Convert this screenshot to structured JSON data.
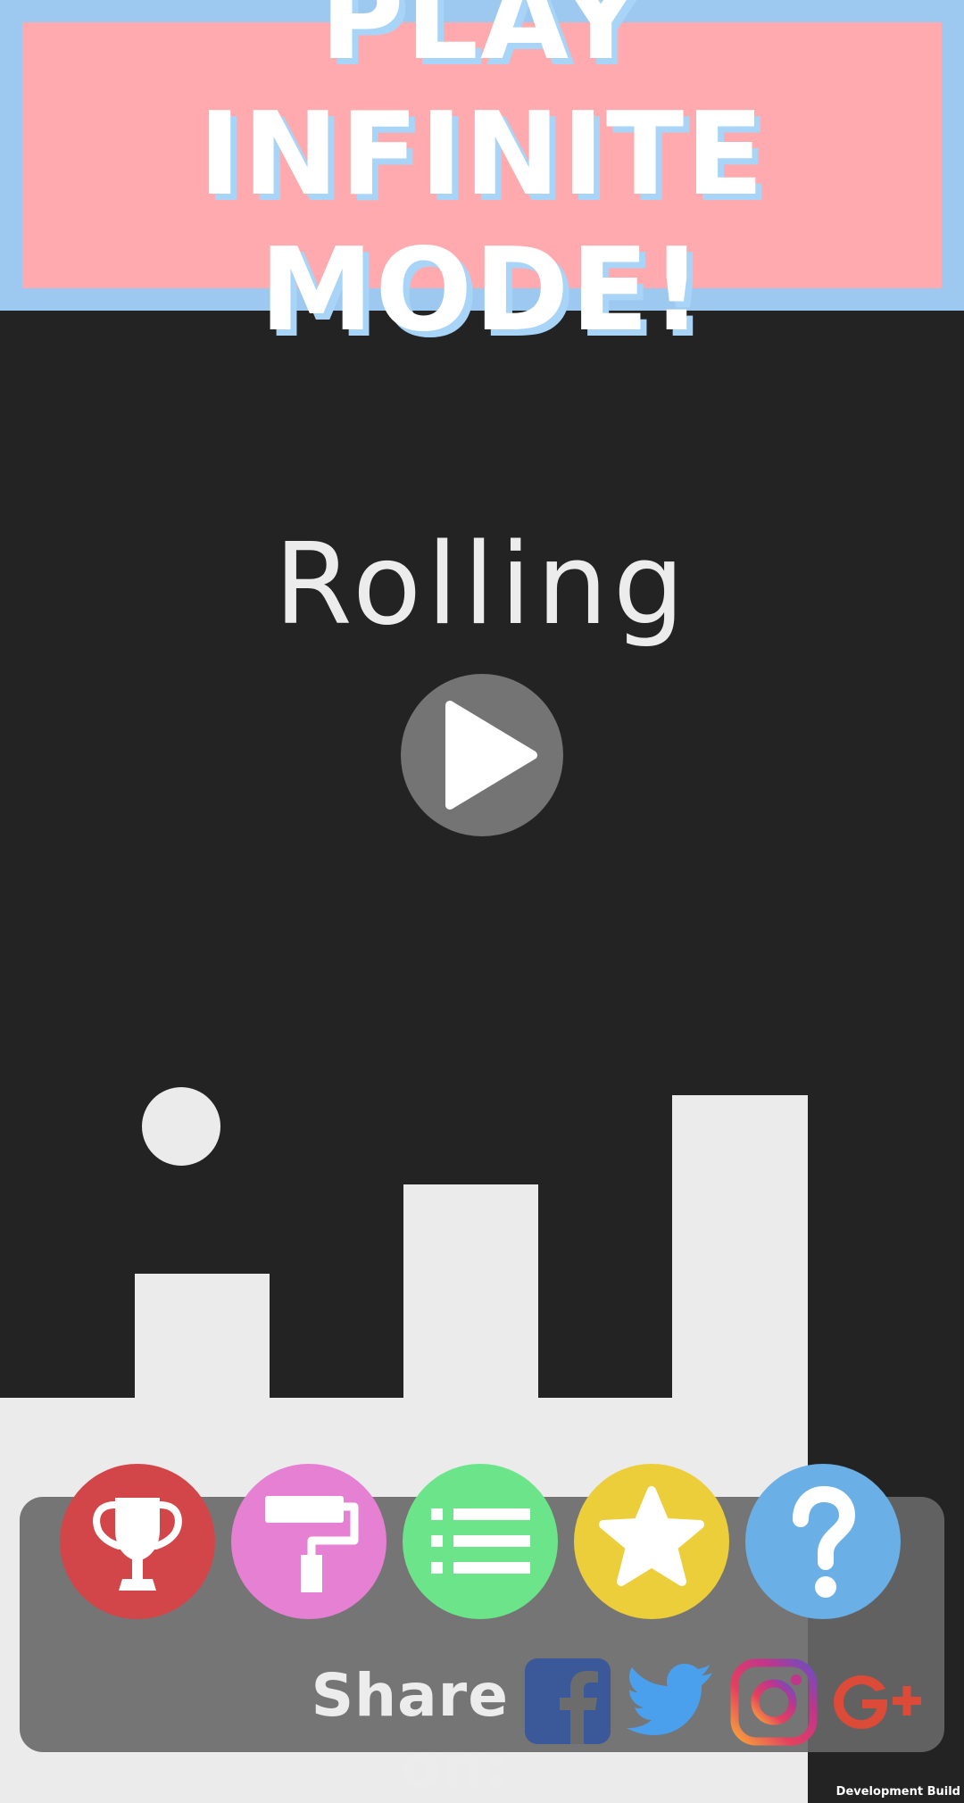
{
  "banner": {
    "line1": "PLAY INFINITE",
    "line2": "MODE!"
  },
  "game": {
    "title": "Rolling"
  },
  "play_icon": "play-icon",
  "menu": {
    "buttons": [
      {
        "name": "leaderboard",
        "icon": "trophy-icon",
        "color": "#d24649"
      },
      {
        "name": "skins",
        "icon": "paint-roller-icon",
        "color": "#e680d3"
      },
      {
        "name": "levels",
        "icon": "list-icon",
        "color": "#6ce58a"
      },
      {
        "name": "rate",
        "icon": "star-icon",
        "color": "#ecce3b"
      },
      {
        "name": "help",
        "icon": "question-icon",
        "color": "#6aafe6"
      }
    ]
  },
  "share": {
    "label": "Share on:",
    "networks": [
      {
        "name": "facebook",
        "icon": "facebook-icon",
        "color": "#3b5998"
      },
      {
        "name": "twitter",
        "icon": "twitter-icon",
        "color": "#4aa0ec"
      },
      {
        "name": "instagram",
        "icon": "instagram-icon",
        "color": "#c1358a"
      },
      {
        "name": "google-plus",
        "icon": "google-plus-icon",
        "color": "#dc4a38"
      }
    ]
  },
  "footer": {
    "build_label": "Development Build"
  },
  "colors": {
    "background": "#232323",
    "terrain": "#ebebeb",
    "banner_border": "#9dc9f1",
    "banner_fill": "#ffaaae"
  }
}
